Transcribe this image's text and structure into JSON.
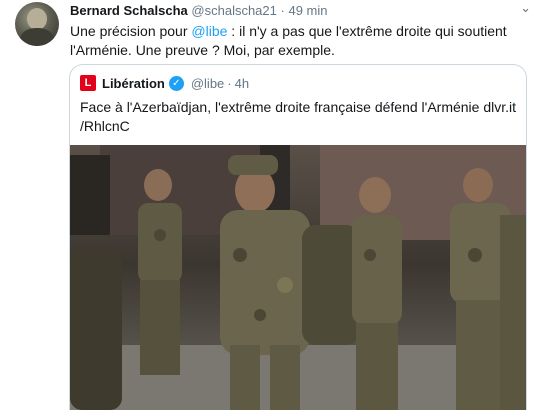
{
  "tweet": {
    "author_name": "Bernard Schalscha",
    "author_handle": "@schalscha21",
    "separator": "·",
    "time": "49 min",
    "text_before_mention": "Une précision pour ",
    "mention": "@libe",
    "text_after_mention": " : il n'y a pas que l'extrême droite qui soutient l'Arménie. Une preuve ? Moi, par exemple.",
    "menu_icon": "chevron-down-icon"
  },
  "quoted": {
    "logo_letter": "L",
    "name": "Libération",
    "handle": "@libe",
    "separator": "·",
    "time": "4h",
    "text": "Face à l'Azerbaïdjan, l'extrême droite française défend l'Arménie dlvr.it /RhlcnC",
    "verified_icon": "verified-check-icon",
    "media_icon": "photo-soldiers-image"
  },
  "colors": {
    "accent": "#1da1f2",
    "muted": "#657786",
    "border": "#ccd6dd",
    "brand_liberation": "#e2001a"
  }
}
